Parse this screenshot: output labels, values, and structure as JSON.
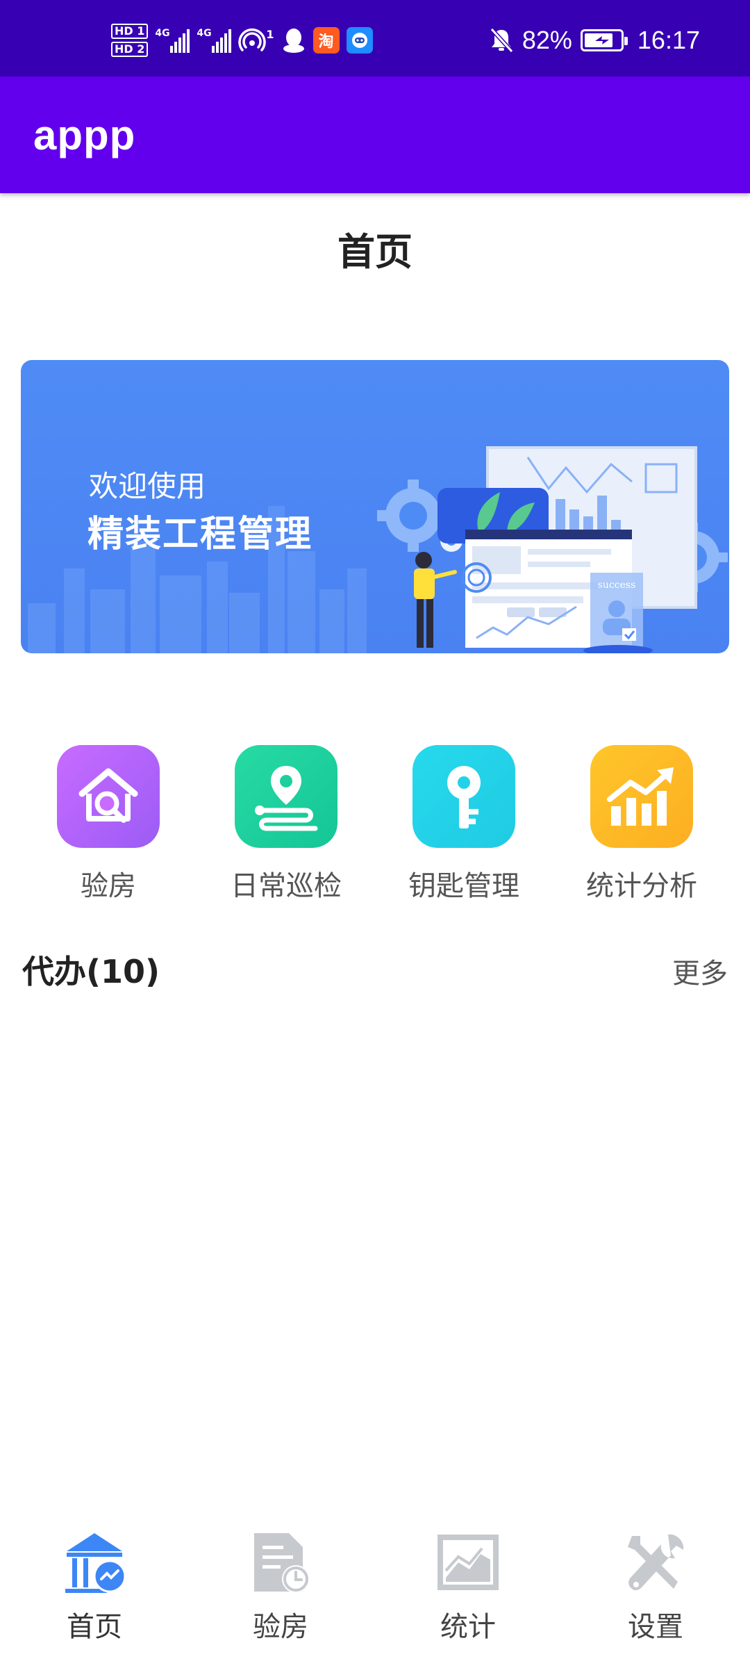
{
  "status_bar": {
    "hd1": "HD 1",
    "hd2": "HD 2",
    "network1": "4G",
    "network2": "4G",
    "hotspot_count": "1",
    "taobao_label": "淘",
    "battery_percent": "82%",
    "battery_level": 0.82,
    "time": "16:17",
    "icons": [
      "signal-icon",
      "hotspot-icon",
      "qq-icon",
      "taobao-icon",
      "assistant-icon",
      "mute-bell-icon",
      "battery-charging-icon"
    ]
  },
  "app_bar": {
    "title": "appp"
  },
  "page": {
    "title": "首页"
  },
  "banner": {
    "subtitle": "欢迎使用",
    "title": "精装工程管理",
    "card_text": "success"
  },
  "quick_actions": [
    {
      "label": "验房",
      "icon": "house-search-icon",
      "color_from": "#c86bff",
      "color_to": "#9b5cf5"
    },
    {
      "label": "日常巡检",
      "icon": "location-route-icon",
      "color_from": "#27dba4",
      "color_to": "#14c596"
    },
    {
      "label": "钥匙管理",
      "icon": "key-icon",
      "color_from": "#27d9ec",
      "color_to": "#1fcbe3"
    },
    {
      "label": "统计分析",
      "icon": "trend-chart-icon",
      "color_from": "#fec62a",
      "color_to": "#fdae22"
    }
  ],
  "todo": {
    "title": "代办(10)",
    "more_label": "更多"
  },
  "bottom_nav": [
    {
      "label": "首页",
      "icon": "home-building-icon",
      "active": true
    },
    {
      "label": "验房",
      "icon": "document-clock-icon",
      "active": false
    },
    {
      "label": "统计",
      "icon": "chart-board-icon",
      "active": false
    },
    {
      "label": "设置",
      "icon": "tools-icon",
      "active": false
    }
  ],
  "colors": {
    "status_bar": "#3700b3",
    "app_bar": "#6200ee",
    "banner": "#4f8bf5",
    "nav_active": "#3d86f6",
    "nav_inactive": "#c6c9ce"
  }
}
